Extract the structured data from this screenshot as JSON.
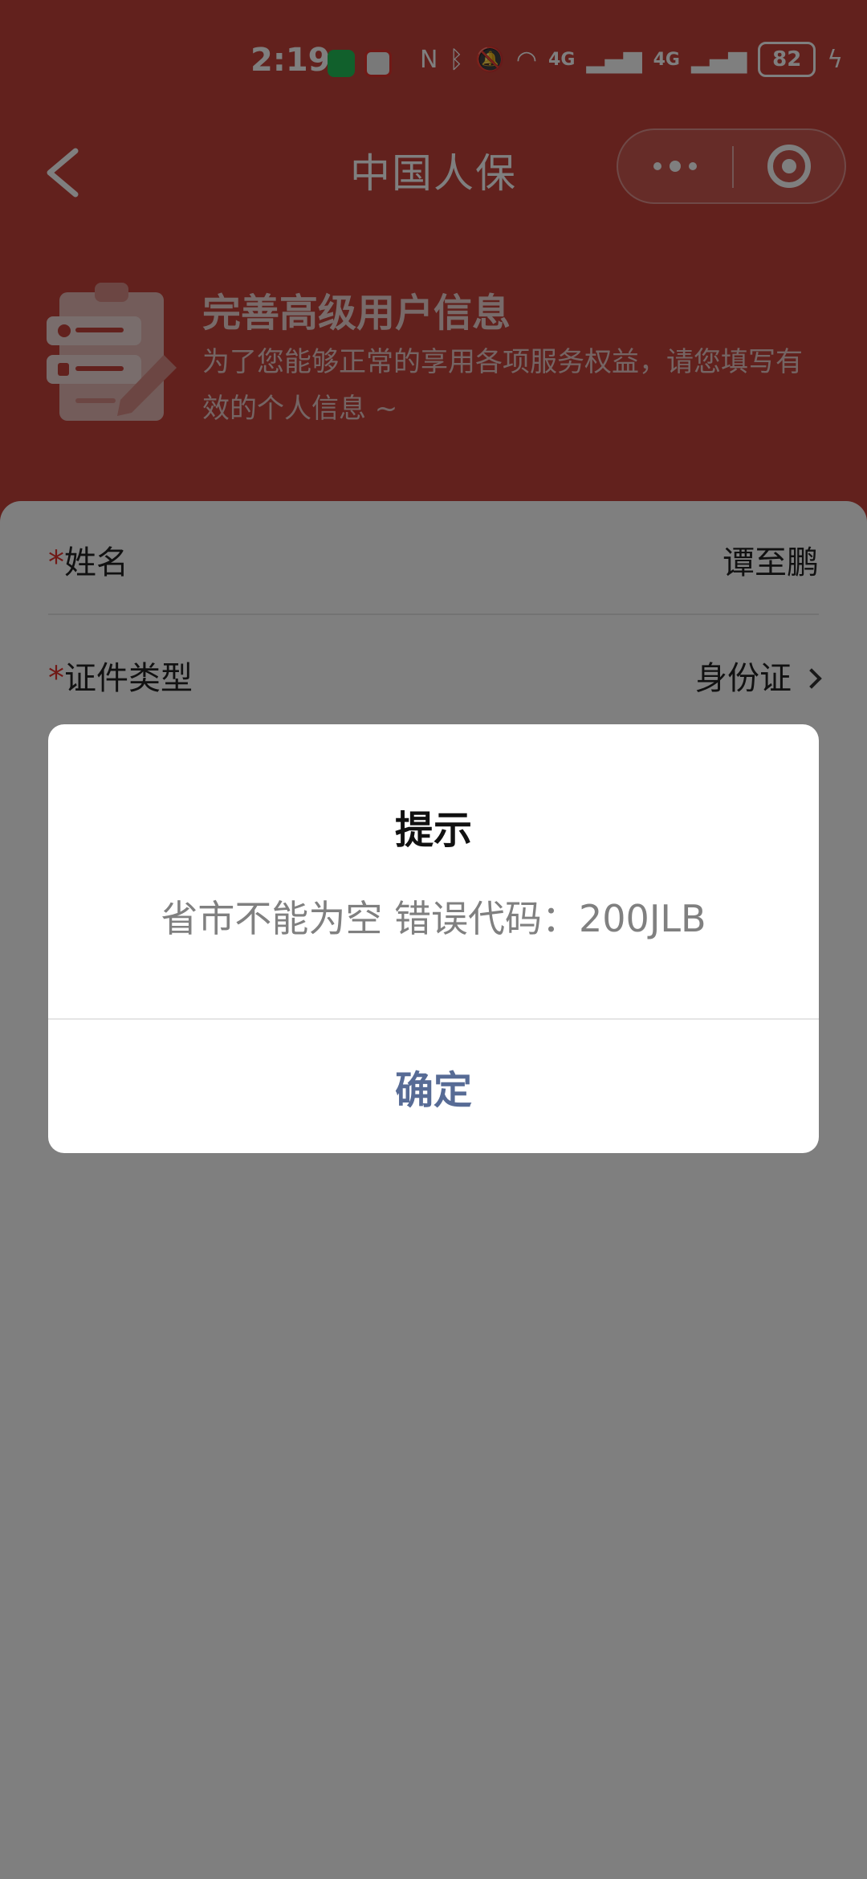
{
  "status_bar": {
    "time": "2:19",
    "signal_1": "4G",
    "signal_2": "4G",
    "battery": "82"
  },
  "navbar": {
    "title": "中国人保"
  },
  "intro": {
    "title": "完善高级用户信息",
    "description": "为了您能够正常的享用各项服务权益，请您填写有效的个人信息 ~"
  },
  "form": {
    "rows": [
      {
        "required_mark": "*",
        "label": "姓名",
        "value": "谭至鹏"
      },
      {
        "required_mark": "*",
        "label": "证件类型",
        "value": "身份证"
      }
    ]
  },
  "dialog": {
    "title": "提示",
    "message": "省市不能为空 错误代码：200JLB",
    "confirm_label": "确定"
  },
  "colors": {
    "header_red": "#C5423A",
    "link_blue": "#576B95",
    "required_red": "#E0322C"
  }
}
